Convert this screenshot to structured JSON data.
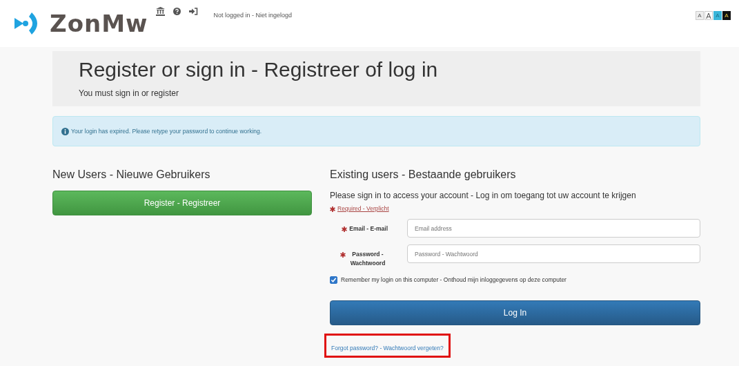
{
  "header": {
    "logo_text": "ZonMw",
    "status": "Not logged in - Niet ingelogd",
    "font_size_buttons": [
      {
        "label": "A",
        "kind": "small"
      },
      {
        "label": "A",
        "kind": "large"
      },
      {
        "label": "A",
        "kind": "cyan"
      },
      {
        "label": "A",
        "kind": "dark"
      }
    ]
  },
  "page": {
    "title": "Register or sign in - Registreer of log in",
    "subtitle": "You must sign in or register"
  },
  "alert": {
    "message": "Your login has expired. Please retype your password to continue working."
  },
  "new_users": {
    "heading": "New Users - Nieuwe Gebruikers",
    "button": "Register - Registreer"
  },
  "existing_users": {
    "heading": "Existing users - Bestaande gebruikers",
    "intro": "Please sign in to access your account - Log in om toegang tot uw account te krijgen",
    "required_note": "Required - Verplicht",
    "fields": [
      {
        "label": "Email - E-mail",
        "placeholder": "Email address"
      },
      {
        "label": "Password - Wachtwoord",
        "placeholder": "Password - Wachtwoord"
      }
    ],
    "remember": {
      "label": "Remember my login on this computer - Onthoud mijn inloggegevens op deze computer",
      "checked": true
    },
    "button": "Log In",
    "forgot_link": {
      "label": "Forgot password? - Wachtwoord vergeten?",
      "highlighted": true
    }
  }
}
